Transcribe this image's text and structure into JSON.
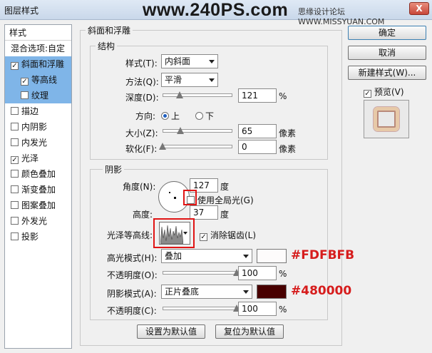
{
  "window": {
    "title": "图层样式",
    "watermark": "www.240PS.com",
    "site_forum": "思缘设计论坛 WWW.MISSYUAN.COM",
    "close_label": "X"
  },
  "sidebar": {
    "header": "样式",
    "items": [
      {
        "label": "混合选项:自定",
        "checked": null
      },
      {
        "label": "斜面和浮雕",
        "checked": true,
        "selected": true
      },
      {
        "label": "等高线",
        "checked": true,
        "selected": true,
        "sub": true
      },
      {
        "label": "纹理",
        "checked": false,
        "selected": true,
        "sub": true
      },
      {
        "label": "描边",
        "checked": false
      },
      {
        "label": "内阴影",
        "checked": false
      },
      {
        "label": "内发光",
        "checked": false
      },
      {
        "label": "光泽",
        "checked": true
      },
      {
        "label": "颜色叠加",
        "checked": false
      },
      {
        "label": "渐变叠加",
        "checked": false
      },
      {
        "label": "图案叠加",
        "checked": false
      },
      {
        "label": "外发光",
        "checked": false
      },
      {
        "label": "投影",
        "checked": false
      }
    ]
  },
  "bevel": {
    "title": "斜面和浮雕",
    "structure_title": "结构",
    "style_label": "样式(T):",
    "style_value": "内斜面",
    "technique_label": "方法(Q):",
    "technique_value": "平滑",
    "depth_label": "深度(D):",
    "depth_value": "121",
    "depth_unit": "%",
    "depth_fraction": 0.24,
    "direction_label": "方向:",
    "dir_up": "上",
    "dir_down": "下",
    "size_label": "大小(Z):",
    "size_value": "65",
    "size_unit": "像素",
    "size_fraction": 0.26,
    "soften_label": "软化(F):",
    "soften_value": "0",
    "soften_unit": "像素",
    "soften_fraction": 0.0
  },
  "shading": {
    "title": "阴影",
    "angle_label": "角度(N):",
    "angle_value": "127",
    "angle_unit": "度",
    "global_light_label": "使用全局光(G)",
    "altitude_label": "高度:",
    "altitude_value": "37",
    "altitude_unit": "度",
    "gloss_contour_label": "光泽等高线:",
    "anti_alias_label": "消除锯齿(L)",
    "highlight_mode_label": "高光模式(H):",
    "highlight_mode_value": "叠加",
    "highlight_color": "#FDFBFB",
    "highlight_opacity_label": "不透明度(O):",
    "highlight_opacity_value": "100",
    "highlight_opacity_unit": "%",
    "shadow_mode_label": "阴影模式(A):",
    "shadow_mode_value": "正片叠底",
    "shadow_color": "#480000",
    "shadow_opacity_label": "不透明度(C):",
    "shadow_opacity_value": "100",
    "shadow_opacity_unit": "%"
  },
  "buttons": {
    "make_default": "设置为默认值",
    "reset_default": "复位为默认值",
    "ok": "确定",
    "cancel": "取消",
    "new_style": "新建样式(W)...",
    "preview": "预览(V)"
  },
  "annotations": {
    "highlight_hex": "#FDFBFB",
    "shadow_hex": "#480000"
  }
}
